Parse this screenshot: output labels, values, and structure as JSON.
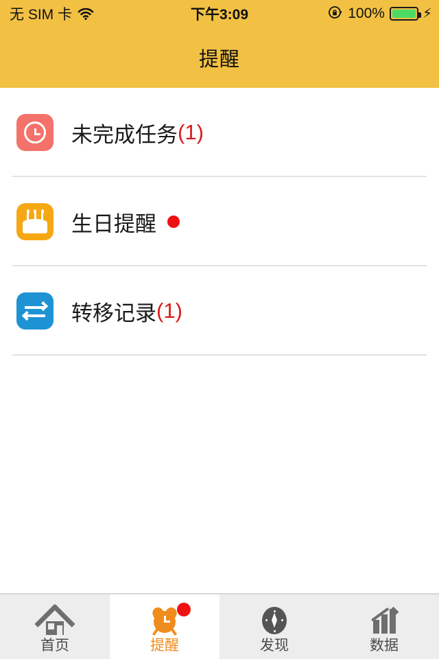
{
  "theme": {
    "brand_color": "#F2C144",
    "accent_color": "#F08C1E",
    "badge_color": "#EE1111",
    "count_color": "#D81B1B",
    "tabbar_bg": "#EDEDED"
  },
  "status_bar": {
    "carrier": "无 SIM 卡",
    "wifi_icon": "wifi-icon",
    "time": "下午3:09",
    "rotation_lock_icon": "rotation-lock-icon",
    "battery_percent": "100%",
    "battery_icon": "battery-full-icon",
    "charging_icon": "charging-bolt-icon"
  },
  "header": {
    "title": "提醒"
  },
  "list": {
    "items": [
      {
        "icon": "clock-icon",
        "icon_color": "#F4726B",
        "label": "未完成任务",
        "count": "(1)",
        "badge": false
      },
      {
        "icon": "birthday-cake-icon",
        "icon_color": "#F5A814",
        "label": "生日提醒",
        "count": "",
        "badge": true
      },
      {
        "icon": "transfer-arrows-icon",
        "icon_color": "#1E93D4",
        "label": "转移记录",
        "count": "(1)",
        "badge": false
      }
    ]
  },
  "tabbar": {
    "tabs": [
      {
        "label": "首页",
        "icon": "home-icon",
        "active": false,
        "badge": false
      },
      {
        "label": "提醒",
        "icon": "alarm-clock-icon",
        "active": true,
        "badge": true
      },
      {
        "label": "发现",
        "icon": "compass-icon",
        "active": false,
        "badge": false
      },
      {
        "label": "数据",
        "icon": "bar-chart-icon",
        "active": false,
        "badge": false
      }
    ]
  }
}
